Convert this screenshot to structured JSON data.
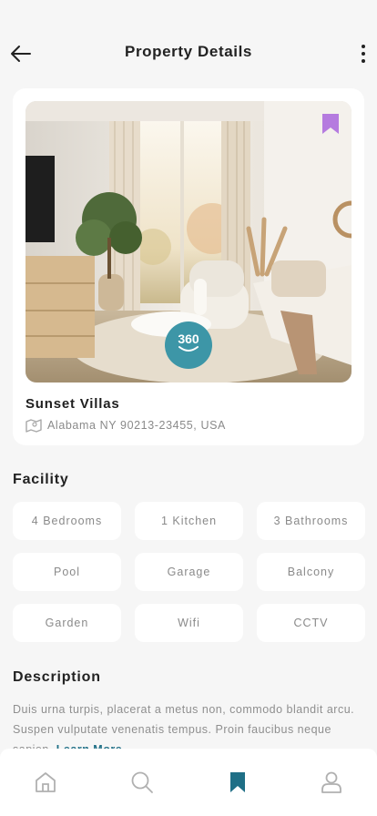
{
  "header": {
    "title": "Property Details",
    "back_icon": "arrow-left-icon",
    "more_icon": "more-vertical-icon"
  },
  "property": {
    "name": "Sunset Villas",
    "address": "Alabama NY 90213-23455, USA",
    "pano_label": "360",
    "bookmark_color": "#b57bdf"
  },
  "facility": {
    "title": "Facility",
    "items": [
      "4 Bedrooms",
      "1 Kitchen",
      "3 Bathrooms",
      "Pool",
      "Garage",
      "Balcony",
      "Garden",
      "Wifi",
      "CCTV"
    ]
  },
  "description": {
    "title": "Description",
    "text": "Duis urna turpis, placerat a metus non, commodo blandit arcu. Suspen vulputate venenatis tempus. Proin faucibus neque sapien.",
    "learn_more": "Learn More"
  },
  "nav": {
    "items": [
      "home-icon",
      "search-icon",
      "bookmark-icon",
      "profile-icon"
    ],
    "active": "bookmark-icon",
    "active_color": "#1f6f86"
  }
}
